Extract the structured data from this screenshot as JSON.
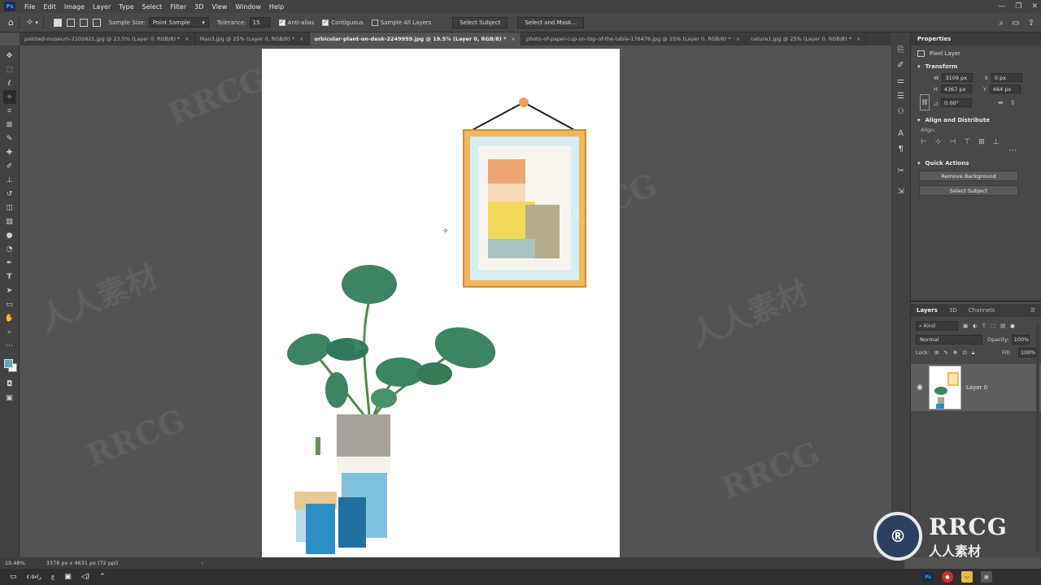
{
  "app": {
    "logo": "Ps",
    "menu": [
      "File",
      "Edit",
      "Image",
      "Layer",
      "Type",
      "Select",
      "Filter",
      "3D",
      "View",
      "Window",
      "Help"
    ],
    "window_controls": [
      "—",
      "❐",
      "✕"
    ]
  },
  "options_bar": {
    "sample_size_label": "Sample Size:",
    "sample_size_value": "Point Sample",
    "tolerance_label": "Tolerance:",
    "tolerance_value": "15",
    "anti_alias_label": "Anti-alias",
    "anti_alias_checked": true,
    "contiguous_label": "Contiguous",
    "contiguous_checked": true,
    "sample_all_label": "Sample All Layers",
    "sample_all_checked": false,
    "select_subject_btn": "Select Subject",
    "select_mask_btn": "Select and Mask..."
  },
  "tabs": [
    {
      "label": "painted-museum-2102621.jpg @ 23.5% (Layer 0, RGB/8) *",
      "active": false
    },
    {
      "label": "Man3.jpg @ 25% (Layer 0, RGB/8) *",
      "active": false
    },
    {
      "label": "orbicular-plant-on-desk-2249959.jpg @ 19.5% (Layer 0, RGB/8) *",
      "active": true
    },
    {
      "label": "photo-of-paper-cup-on-top-of-the-table-176476.jpg @ 25% (Layer 0, RGB/8) *",
      "active": false
    },
    {
      "label": "nature1.jpg @ 25% (Layer 0, RGB/8) *",
      "active": false
    }
  ],
  "status": {
    "zoom": "19.48%",
    "doc_size": "3376 px x 4631 px (72 ppi)"
  },
  "properties": {
    "title": "Properties",
    "layer_type": "Pixel Layer",
    "transform_title": "Transform",
    "w_label": "W",
    "w_value": "3109 px",
    "h_label": "H",
    "h_value": "4367 px",
    "x_label": "X",
    "x_value": "0 px",
    "y_label": "Y",
    "y_value": "464 px",
    "angle_value": "0.00°",
    "align_title": "Align and Distribute",
    "align_label": "Align:",
    "quick_actions_title": "Quick Actions",
    "remove_bg_btn": "Remove Background",
    "select_subject_btn": "Select Subject"
  },
  "layers_panel": {
    "tabs": [
      "Layers",
      "3D",
      "Channels"
    ],
    "filter_kind": "Kind",
    "blend_mode": "Normal",
    "opacity_label": "Opacity:",
    "opacity_value": "100%",
    "lock_label": "Lock:",
    "fill_label": "Fill:",
    "fill_value": "100%",
    "layer_name": "Layer 0"
  },
  "taskbar": {
    "time_label": "﻿ﺭﺍﺀ٤:٥",
    "lang": "ع"
  },
  "watermark": {
    "rrcg_text": "RRCG",
    "rrcg_cn": "人人素材"
  },
  "colors": {
    "foreground": "#63a5b8",
    "background": "#ffffff"
  }
}
